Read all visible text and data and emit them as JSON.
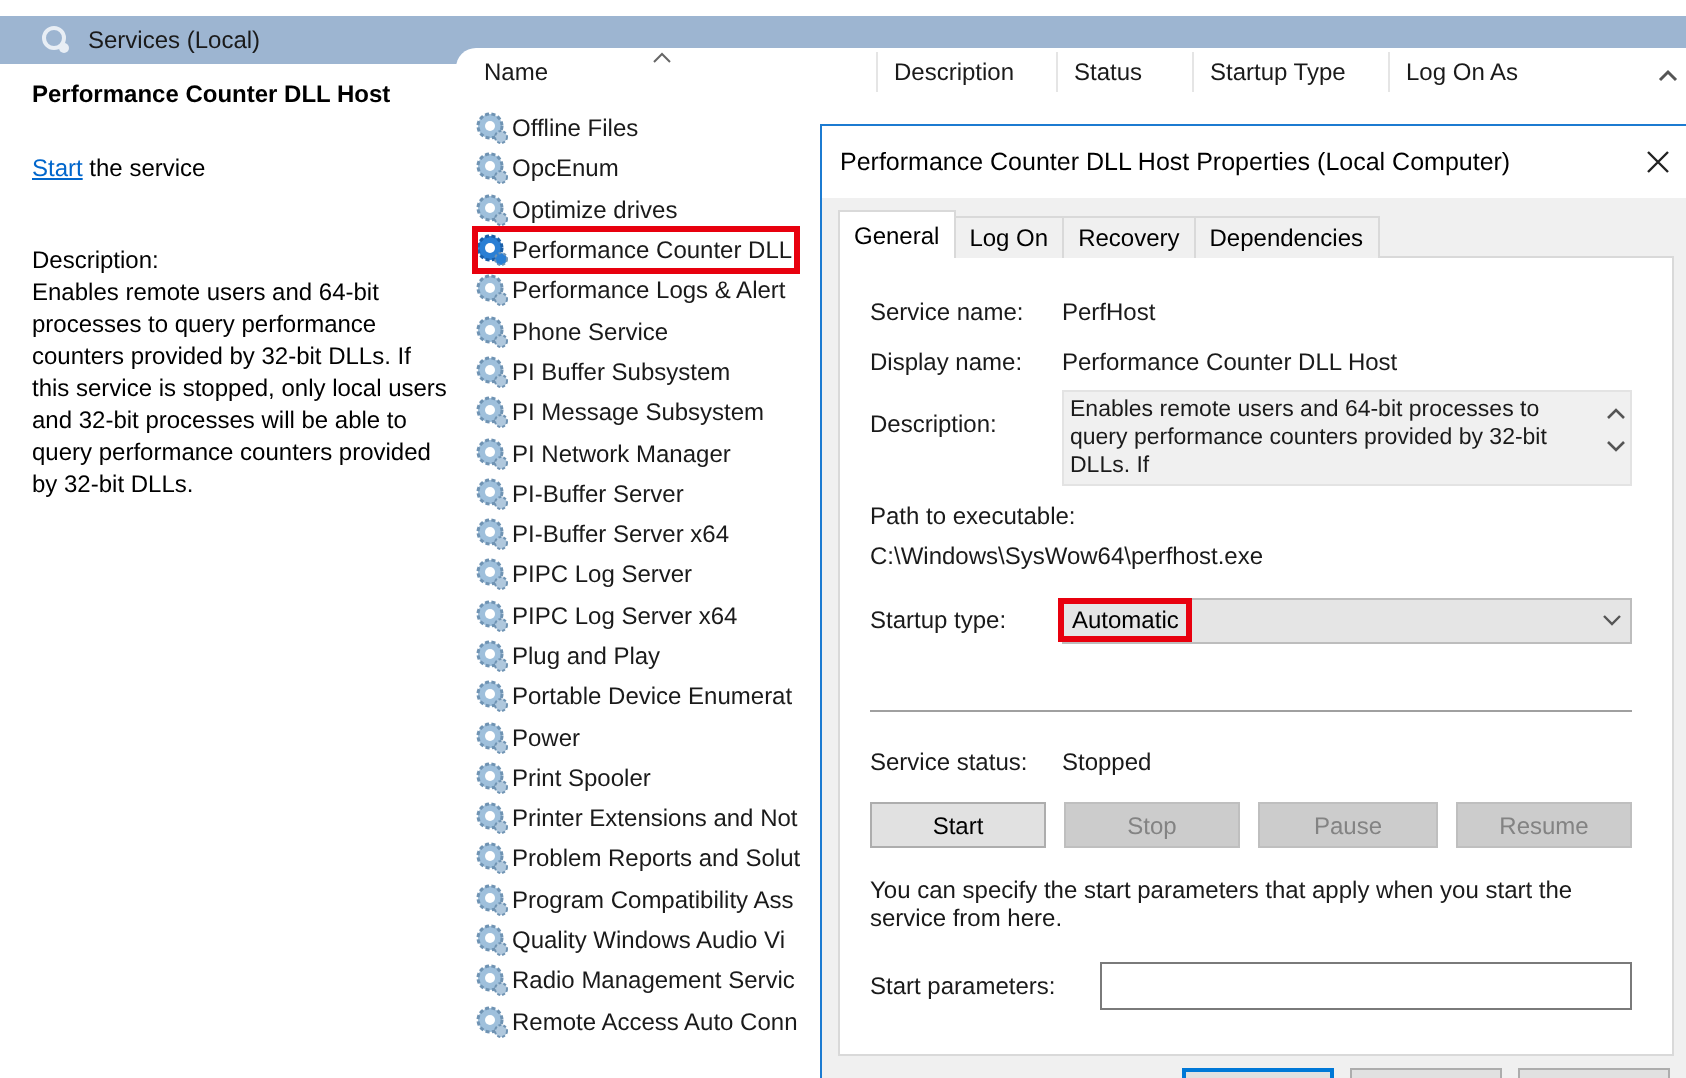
{
  "header": {
    "title": "Services (Local)"
  },
  "details": {
    "title": "Performance Counter DLL Host",
    "action_link": "Start",
    "action_rest": " the service",
    "description_label": "Description:",
    "description": "Enables remote users and 64-bit processes to query performance counters provided by 32-bit DLLs. If this service is stopped, only local users and 32-bit processes will be able to query performance counters provided by 32-bit DLLs."
  },
  "table": {
    "columns": [
      "Name",
      "Description",
      "Status",
      "Startup Type",
      "Log On As"
    ],
    "rows": [
      {
        "name": "Offline Files",
        "selected": false,
        "highlighted": false
      },
      {
        "name": "OpcEnum",
        "selected": false,
        "highlighted": false
      },
      {
        "name": "Optimize drives",
        "selected": false,
        "highlighted": false
      },
      {
        "name": "Performance Counter DLL",
        "selected": true,
        "highlighted": true
      },
      {
        "name": "Performance Logs & Alert",
        "selected": false,
        "highlighted": false
      },
      {
        "name": "Phone Service",
        "selected": false,
        "highlighted": false
      },
      {
        "name": "PI Buffer Subsystem",
        "selected": false,
        "highlighted": false
      },
      {
        "name": "PI Message Subsystem",
        "selected": false,
        "highlighted": false
      },
      {
        "name": "PI Network Manager",
        "selected": false,
        "highlighted": false
      },
      {
        "name": "PI-Buffer Server",
        "selected": false,
        "highlighted": false
      },
      {
        "name": "PI-Buffer Server x64",
        "selected": false,
        "highlighted": false
      },
      {
        "name": "PIPC Log Server",
        "selected": false,
        "highlighted": false
      },
      {
        "name": "PIPC Log Server x64",
        "selected": false,
        "highlighted": false
      },
      {
        "name": "Plug and Play",
        "selected": false,
        "highlighted": false
      },
      {
        "name": "Portable Device Enumerat",
        "selected": false,
        "highlighted": false
      },
      {
        "name": "Power",
        "selected": false,
        "highlighted": false
      },
      {
        "name": "Print Spooler",
        "selected": false,
        "highlighted": false
      },
      {
        "name": "Printer Extensions and Not",
        "selected": false,
        "highlighted": false
      },
      {
        "name": "Problem Reports and Solut",
        "selected": false,
        "highlighted": false
      },
      {
        "name": "Program Compatibility Ass",
        "selected": false,
        "highlighted": false
      },
      {
        "name": "Quality Windows Audio Vi",
        "selected": false,
        "highlighted": false
      },
      {
        "name": "Radio Management Servic",
        "selected": false,
        "highlighted": false
      },
      {
        "name": "Remote Access Auto Conn",
        "selected": false,
        "highlighted": false
      }
    ]
  },
  "dialog": {
    "title": "Performance Counter DLL Host Properties (Local Computer)",
    "tabs": [
      {
        "label": "General",
        "selected": true
      },
      {
        "label": "Log On",
        "selected": false
      },
      {
        "label": "Recovery",
        "selected": false
      },
      {
        "label": "Dependencies",
        "selected": false
      }
    ],
    "fields": [
      {
        "label": "Service name:",
        "value": "PerfHost"
      },
      {
        "label": "Display name:",
        "value": "Performance Counter DLL Host"
      }
    ],
    "description": {
      "label": "Description:",
      "value": "Enables remote users and 64-bit processes to query performance counters provided by 32-bit DLLs. If"
    },
    "path": {
      "label": "Path to executable:",
      "value": "C:\\Windows\\SysWow64\\perfhost.exe"
    },
    "startup": {
      "label": "Startup type:",
      "value": "Automatic",
      "highlighted": true
    },
    "status": {
      "label": "Service status:",
      "value": "Stopped"
    },
    "buttons": [
      {
        "label": "Start",
        "disabled": false
      },
      {
        "label": "Stop",
        "disabled": true
      },
      {
        "label": "Pause",
        "disabled": true
      },
      {
        "label": "Resume",
        "disabled": true
      }
    ],
    "hint": "You can specify the start parameters that apply when you start the service from here.",
    "params": {
      "label": "Start parameters:"
    },
    "footer_buttons": [
      {
        "default": true
      },
      {
        "default": false
      },
      {
        "default": false
      }
    ]
  }
}
